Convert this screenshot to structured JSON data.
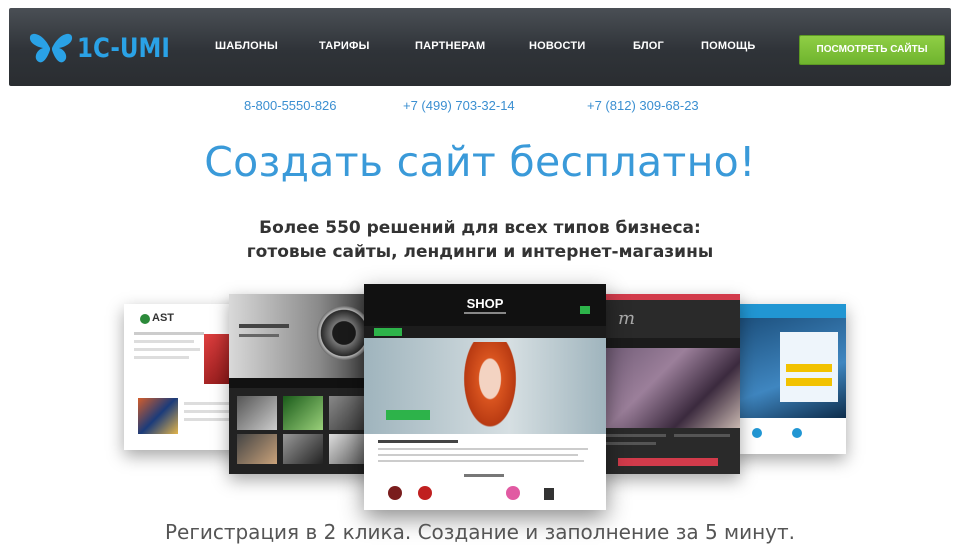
{
  "header": {
    "logo_text": "1C-UMI",
    "nav": [
      {
        "label": "ШАБЛОНЫ"
      },
      {
        "label": "ТАРИФЫ"
      },
      {
        "label": "ПАРТНЕРАМ"
      },
      {
        "label": "НОВОСТИ"
      },
      {
        "label": "БЛОГ"
      },
      {
        "label": "ПОМОЩЬ"
      }
    ],
    "cta_label": "ПОСМОТРЕТЬ САЙТЫ"
  },
  "phones": [
    "8-800-5550-826",
    "+7 (499) 703-32-14",
    "+7 (812) 309-68-23"
  ],
  "hero": {
    "title": "Создать сайт бесплатно!",
    "subtitle_line1": "Более 550 решений для всех типов бизнеса:",
    "subtitle_line2": "готовые сайты, лендинги и интернет-магазины"
  },
  "showcase": {
    "shop_logo": "SHOP",
    "left_logo": "AST"
  },
  "footer_text": "Регистрация в 2 клика. Создание и заполнение за 5 минут.",
  "colors": {
    "brand_blue": "#3a9ad9",
    "header_dark": "#2f3338",
    "cta_green": "#7cc03a"
  }
}
